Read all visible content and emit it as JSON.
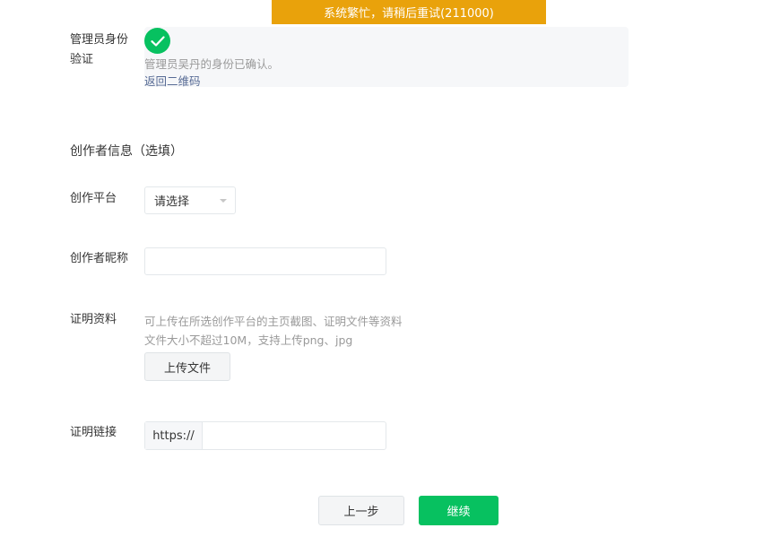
{
  "toast": {
    "message": "系统繁忙，请稍后重试(211000)",
    "color": "#e9a20b"
  },
  "admin_verify": {
    "label_line1": "管理员身份",
    "label_line2": "验证",
    "status_icon": "check-circle-icon",
    "confirmed_text": "管理员吴丹的身份已确认。",
    "back_link": "返回二维码"
  },
  "creator_info": {
    "section_title": "创作者信息（选填）",
    "platform": {
      "label": "创作平台",
      "selected": "请选择"
    },
    "nickname": {
      "label": "创作者昵称",
      "value": "",
      "placeholder": ""
    },
    "proof": {
      "label": "证明资料",
      "hint_line1": "可上传在所选创作平台的主页截图、证明文件等资料",
      "hint_line2": "文件大小不超过10M，支持上传png、jpg",
      "upload_button": "上传文件"
    },
    "proof_link": {
      "label": "证明链接",
      "prefix": "https://",
      "value": "",
      "placeholder": ""
    }
  },
  "actions": {
    "prev_label": "上一步",
    "next_label": "继续",
    "primary_color": "#07c160"
  }
}
